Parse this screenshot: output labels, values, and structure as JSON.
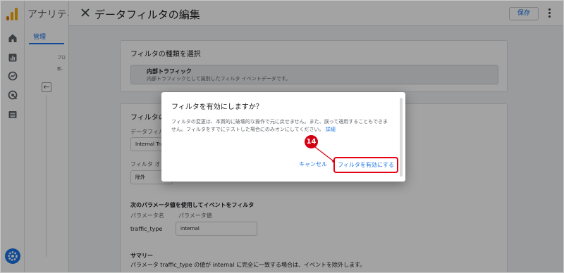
{
  "app": {
    "title": "アナリティ"
  },
  "left_nav": {
    "tab": "管理",
    "small_1": "プロ",
    "small_2": "新-"
  },
  "panel": {
    "title": "データフィルタの編集",
    "save_label": "保存",
    "card1": {
      "heading": "フィルタの種類を選択",
      "option_title": "内部トラフィック",
      "option_desc": "内部トラフィックとして識別したフィルタ イベントデータです。"
    },
    "card2": {
      "heading": "フィルタの",
      "name_label": "データフィル",
      "name_value": "Internal Tra",
      "op_label": "フィルタ オ",
      "op_value": "除外",
      "params_heading": "次のパラメータ値を使用してイベントをフィルタ",
      "param_name_label": "パラメータ名",
      "param_value_label": "パラメータ値",
      "param_name": "traffic_type",
      "param_value": "internal",
      "summary_heading": "サマリー",
      "summary_text": "パラメータ traffic_type の値が internal に完全に一致する場合は、イベントを除外します。"
    }
  },
  "dialog": {
    "title": "フィルタを有効にしますか？",
    "body": "フィルタの変更は、本質的に破壊的な操作で元に戻せません。また、誤って適用することもできません。フィルタをすでにテストした場合にのみオンにしてください。",
    "link": "詳細",
    "cancel_label": "キャンセル",
    "enable_label": "フィルタを有効にする"
  },
  "annotation": {
    "step_number": "14"
  },
  "colors": {
    "accent": "#1a73e8",
    "highlight": "#e60012",
    "overlay": "rgba(0,0,0,0.36)"
  }
}
